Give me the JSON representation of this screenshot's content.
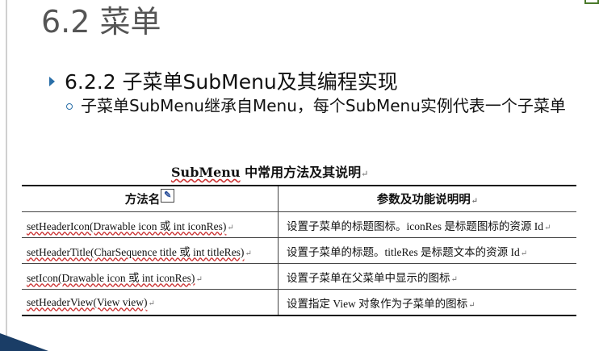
{
  "slide": {
    "title": "6.2 菜单",
    "bullet_level1": "6.2.2 子菜单SubMenu及其编程实现",
    "bullet_level2": "子菜单SubMenu继承自Menu，每个SubMenu实例代表一个子菜单"
  },
  "table": {
    "caption_prefix": "SubMenu",
    "caption_rest": " 中常用方法及其说明",
    "return_mark": "↵",
    "headers": {
      "method": "方法名",
      "desc": "参数及功能说明明"
    },
    "rows": [
      {
        "method": "setHeaderIcon(Drawable  icon 或 int iconRes)",
        "desc": "设置子菜单的标题图标。iconRes 是标题图标的资源 Id"
      },
      {
        "method": "setHeaderTitle(CharSequence  title 或 int titleRes)",
        "desc": "设置子菜单的标题。titleRes 是标题文本的资源 Id"
      },
      {
        "method": "setIcon(Drawable  icon 或 int iconRes)",
        "desc": "设置子菜单在父菜单中显示的图标"
      },
      {
        "method": "setHeaderView(View  view)",
        "desc": "设置指定 View 对象作为子菜单的图标"
      }
    ]
  },
  "icons": {
    "bullet_arrow": "triangle-right-icon",
    "bullet_circle": "hollow-circle-icon",
    "edit_marker": "edit-marker-icon"
  },
  "colors": {
    "title": "#555555",
    "bullet_accent": "#2a6fa8",
    "corner": "#1a3d66"
  }
}
